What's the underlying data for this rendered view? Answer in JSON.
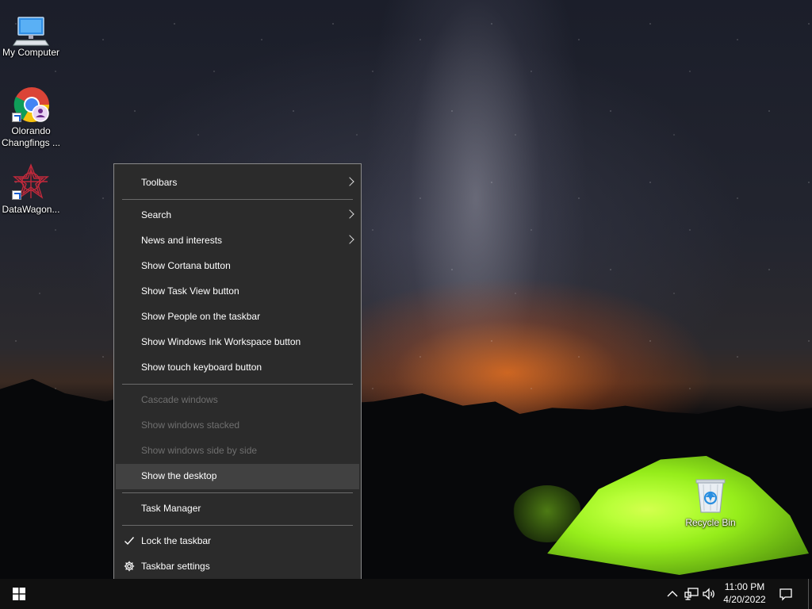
{
  "desktop": {
    "icons": [
      {
        "label": "My Computer"
      },
      {
        "label": "Olorando Changfings ..."
      },
      {
        "label": "DataWagon..."
      },
      {
        "label": "Recycle Bin"
      }
    ]
  },
  "context_menu": {
    "items": [
      {
        "label": "Toolbars",
        "submenu": true,
        "disabled": false
      },
      {
        "label": "Search",
        "submenu": true,
        "disabled": false
      },
      {
        "label": "News and interests",
        "submenu": true,
        "disabled": false
      },
      {
        "label": "Show Cortana button",
        "disabled": false
      },
      {
        "label": "Show Task View button",
        "disabled": false
      },
      {
        "label": "Show People on the taskbar",
        "disabled": false
      },
      {
        "label": "Show Windows Ink Workspace button",
        "disabled": false
      },
      {
        "label": "Show touch keyboard button",
        "disabled": false
      },
      {
        "label": "Cascade windows",
        "disabled": true
      },
      {
        "label": "Show windows stacked",
        "disabled": true
      },
      {
        "label": "Show windows side by side",
        "disabled": true
      },
      {
        "label": "Show the desktop",
        "disabled": false,
        "highlighted": true
      },
      {
        "label": "Task Manager",
        "disabled": false
      },
      {
        "label": "Lock the taskbar",
        "checked": true,
        "disabled": false
      },
      {
        "label": "Taskbar settings",
        "icon": "gear-icon",
        "disabled": false
      }
    ]
  },
  "taskbar": {
    "start_icon": "windows-logo-icon",
    "tray_icons": [
      "chevron-up-icon",
      "network-icon",
      "volume-icon"
    ],
    "time": "11:00 PM",
    "date": "4/20/2022",
    "notification_icon": "action-center-icon"
  },
  "colors": {
    "menu_bg": "#2b2b2b",
    "menu_hover": "#414141",
    "menu_disabled_text": "#6f6f6f",
    "taskbar_bg": "#101010"
  }
}
